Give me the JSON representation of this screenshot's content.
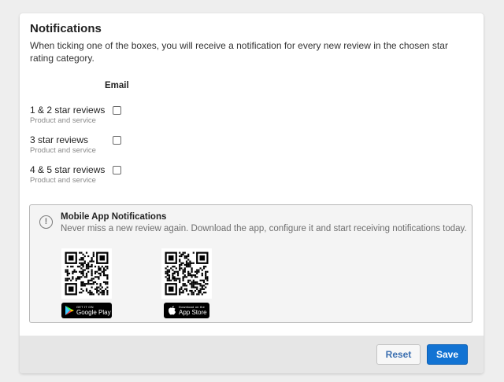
{
  "notifications": {
    "title": "Notifications",
    "description": "When ticking one of the boxes, you will receive a notification for every new review in the chosen star rating category.",
    "column_header": "Email",
    "rows": [
      {
        "label": "1 & 2 star reviews",
        "sub": "Product and service",
        "email_checked": false
      },
      {
        "label": "3 star reviews",
        "sub": "Product and service",
        "email_checked": false
      },
      {
        "label": "4 & 5 star reviews",
        "sub": "Product and service",
        "email_checked": false
      }
    ]
  },
  "mobile": {
    "title": "Mobile App Notifications",
    "text": "Never miss a new review again. Download the app, configure it and start receiving notifications today.",
    "google_play": {
      "small": "GET IT ON",
      "big": "Google Play"
    },
    "app_store": {
      "small": "Download on the",
      "big": "App Store"
    }
  },
  "footer": {
    "reset_label": "Reset",
    "save_label": "Save"
  },
  "colors": {
    "accent": "#1273d3",
    "reset_text": "#3b6fb0"
  },
  "icons": {
    "info": "exclamation-circle-icon",
    "google_play": "google-play-icon",
    "app_store": "apple-icon"
  }
}
